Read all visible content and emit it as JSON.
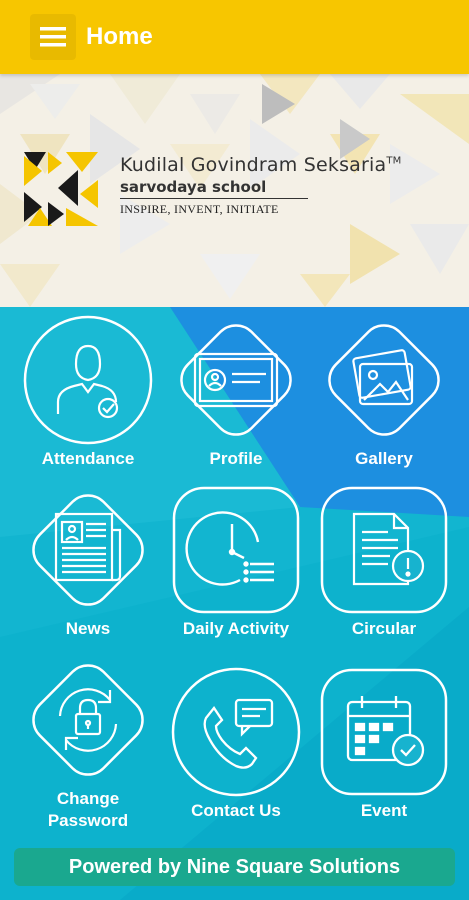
{
  "header": {
    "title": "Home",
    "menu_icon": "hamburger-menu-icon"
  },
  "banner": {
    "school_name": "Kudilal Govindram Seksaria",
    "trademark": "TM",
    "school_subtitle": "sarvodaya school",
    "tagline": "INSPIRE, INVENT, INITIATE"
  },
  "tiles": [
    {
      "label": "Attendance",
      "icon": "user-check-icon"
    },
    {
      "label": "Profile",
      "icon": "id-card-icon"
    },
    {
      "label": "Gallery",
      "icon": "photos-icon"
    },
    {
      "label": "News",
      "icon": "newspaper-icon"
    },
    {
      "label": "Daily Activity",
      "icon": "clock-list-icon"
    },
    {
      "label": "Circular",
      "icon": "document-alert-icon"
    },
    {
      "label_line1": "Change",
      "label_line2": "Password",
      "icon": "lock-refresh-icon"
    },
    {
      "label": "Contact Us",
      "icon": "phone-chat-icon"
    },
    {
      "label": "Event",
      "icon": "calendar-check-icon"
    }
  ],
  "footer": {
    "text": "Powered by Nine Square Solutions"
  },
  "colors": {
    "topbar": "#f7c600",
    "grid_bg": "#0fb3cf",
    "footer": "#1aa88f",
    "logo_yellow": "#f5c500"
  }
}
